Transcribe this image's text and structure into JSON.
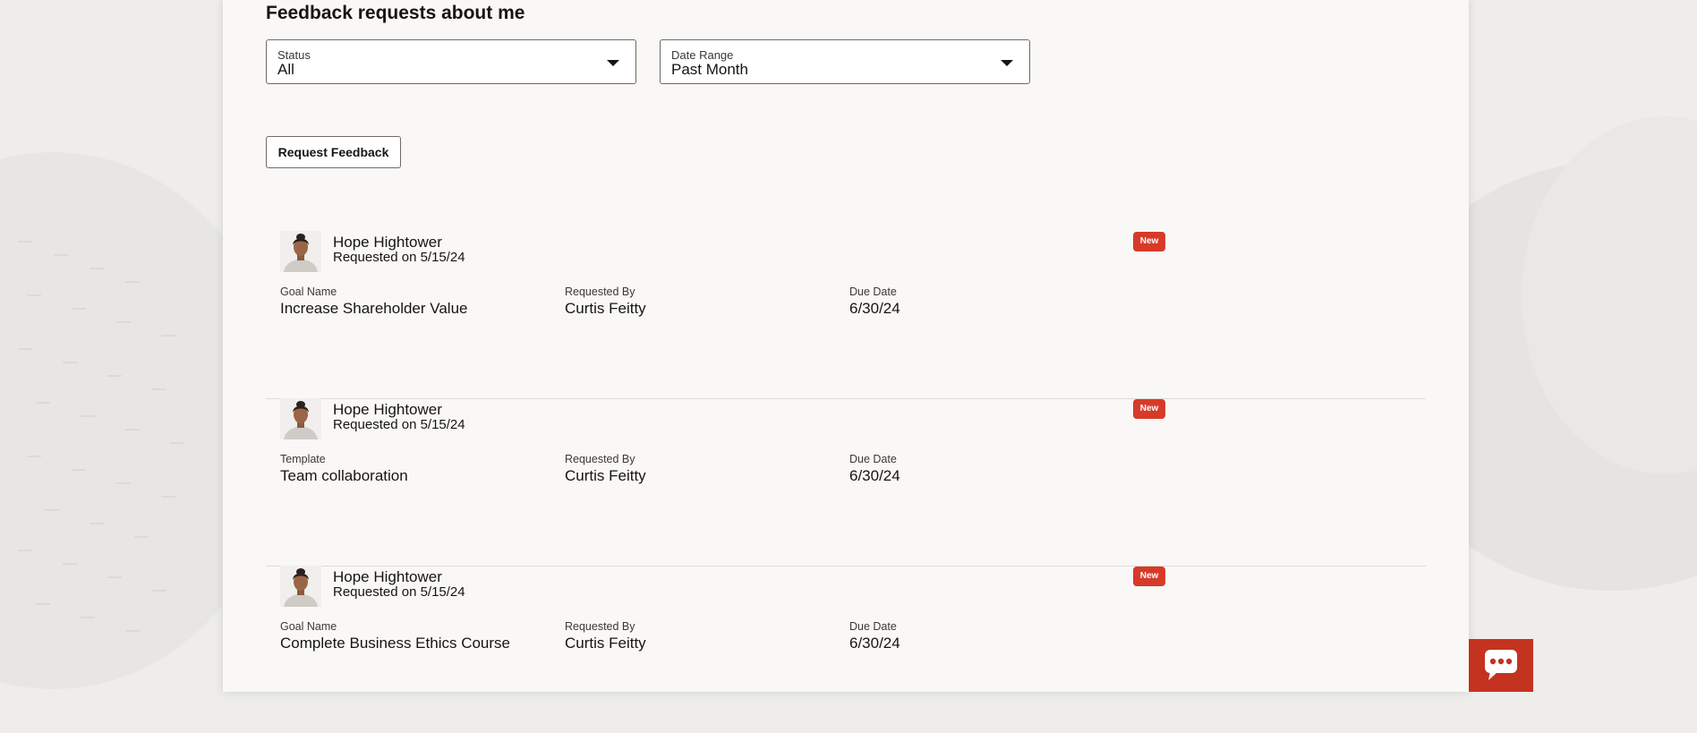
{
  "header": {
    "title": "Feedback requests about me"
  },
  "filters": {
    "status": {
      "label": "Status",
      "value": "All"
    },
    "date_range": {
      "label": "Date Range",
      "value": "Past Month"
    }
  },
  "actions": {
    "request_feedback": "Request Feedback"
  },
  "requests": [
    {
      "name": "Hope Hightower",
      "requested_on": "Requested on 5/15/24",
      "badge": "New",
      "field1_label": "Goal Name",
      "field1_value": "Increase Shareholder Value",
      "requested_by_label": "Requested By",
      "requested_by": "Curtis Feitty",
      "due_label": "Due Date",
      "due": "6/30/24"
    },
    {
      "name": "Hope Hightower",
      "requested_on": "Requested on 5/15/24",
      "badge": "New",
      "field1_label": "Template",
      "field1_value": "Team collaboration",
      "requested_by_label": "Requested By",
      "requested_by": "Curtis Feitty",
      "due_label": "Due Date",
      "due": "6/30/24"
    },
    {
      "name": "Hope Hightower",
      "requested_on": "Requested on 5/15/24",
      "badge": "New",
      "field1_label": "Goal Name",
      "field1_value": "Complete Business Ethics Course",
      "requested_by_label": "Requested By",
      "requested_by": "Curtis Feitty",
      "due_label": "Due Date",
      "due": "6/30/24"
    }
  ],
  "icons": {
    "status_caret": "chevron-down-icon",
    "date_caret": "chevron-down-icon",
    "chat": "chat-icon"
  },
  "colors": {
    "badge": "#d73a29",
    "chat_button": "#c4331f",
    "panel": "#f9f8f6",
    "background": "#eeedeb"
  }
}
